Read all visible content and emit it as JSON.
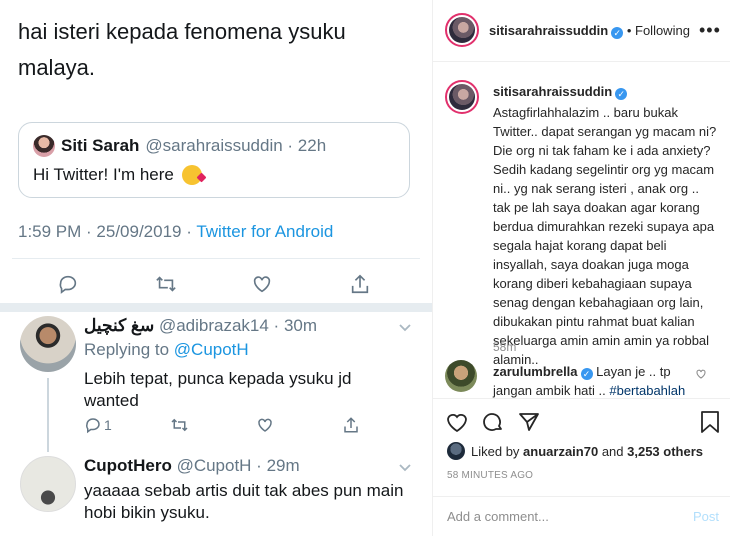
{
  "tweet": {
    "body_line1": "hai isteri kepada fenomena ysuku",
    "body_line2": "malaya.",
    "quote": {
      "name": "Siti Sarah",
      "handle": "@sarahraissuddin · 22h",
      "text": "Hi Twitter! I'm here"
    },
    "time": "1:59 PM · 25/09/2019 · ",
    "source": "Twitter for Android"
  },
  "replies": [
    {
      "name": "سغ كنچيل",
      "handle": "@adibrazak14 · 30m",
      "replying_prefix": "Replying to ",
      "replying_to": "@CupotH",
      "text_line1": "Lebih tepat, punca kepada ysuku jd",
      "text_line2": "wanted",
      "reply_count": "1"
    },
    {
      "name": "CupotHero",
      "handle": "@CupotH · 29m",
      "text_line1": "yaaaaa sebab artis duit tak abes pun main",
      "text_line2": "hobi bikin ysuku."
    }
  ],
  "instagram": {
    "username": "sitisarahraissuddin",
    "follow_status": "• Following",
    "caption_lines": [
      "Astagfirlahhalazim .. baru bukak",
      "Twitter.. dapat serangan yg macam ni?",
      "Die org ni tak faham ke i ada anxiety?",
      "Sedih kadang segelintir org yg macam",
      "ni.. yg nak serang isteri , anak org ..",
      "tak pe lah saya doakan agar korang",
      "berdua dimurahkan rezeki supaya apa",
      "segala hajat korang dapat beli",
      "insyallah, saya doakan juga moga",
      "korang diberi kebahagiaan supaya",
      "senag dengan kebahagiaan org lain,",
      "dibukakan pintu rahmat buat kalian",
      "sekeluarga amin amin amin ya robbal",
      "alamin.."
    ],
    "caption_time": "58m",
    "comment": {
      "username": "zarulumbrella",
      "text_line1": "Layan je .. tp",
      "text_line2": "jangan ambik hati .. ",
      "hashtag": "#bertabahlah"
    },
    "likes_prefix": "Liked by ",
    "liked_by": "anuarzain70",
    "likes_mid": " and ",
    "likes_count": "3,253 others",
    "posted_ago": "58 MINUTES AGO",
    "add_comment_placeholder": "Add a comment...",
    "post_label": "Post"
  }
}
